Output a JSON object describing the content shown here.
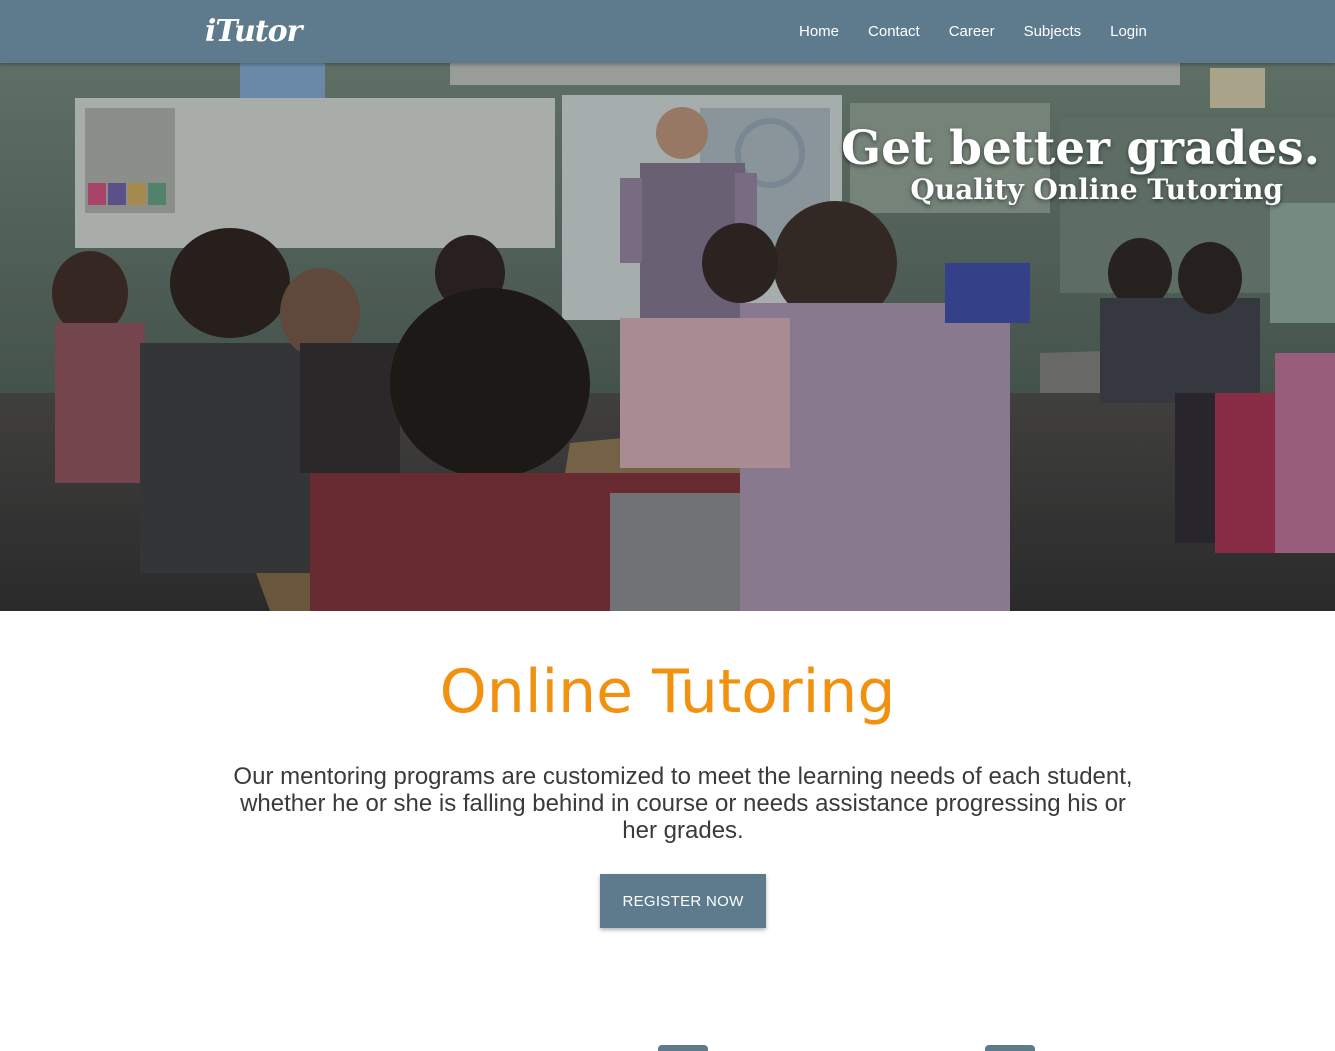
{
  "navbar": {
    "brand": "iTutor",
    "links": [
      "Home",
      "Contact",
      "Career",
      "Subjects",
      "Login"
    ]
  },
  "hero": {
    "headline": "Get better grades.",
    "subheadline": "Quality Online Tutoring"
  },
  "main": {
    "title": "Online Tutoring",
    "description": "Our mentoring programs are customized to meet the learning needs of each student, whether he or she is falling behind in course or needs assistance progressing his or her grades.",
    "cta_label": "REGISTER NOW"
  },
  "colors": {
    "navbar": "#5d7b8c",
    "accent": "#f2900f",
    "button": "#5d7b8c"
  }
}
